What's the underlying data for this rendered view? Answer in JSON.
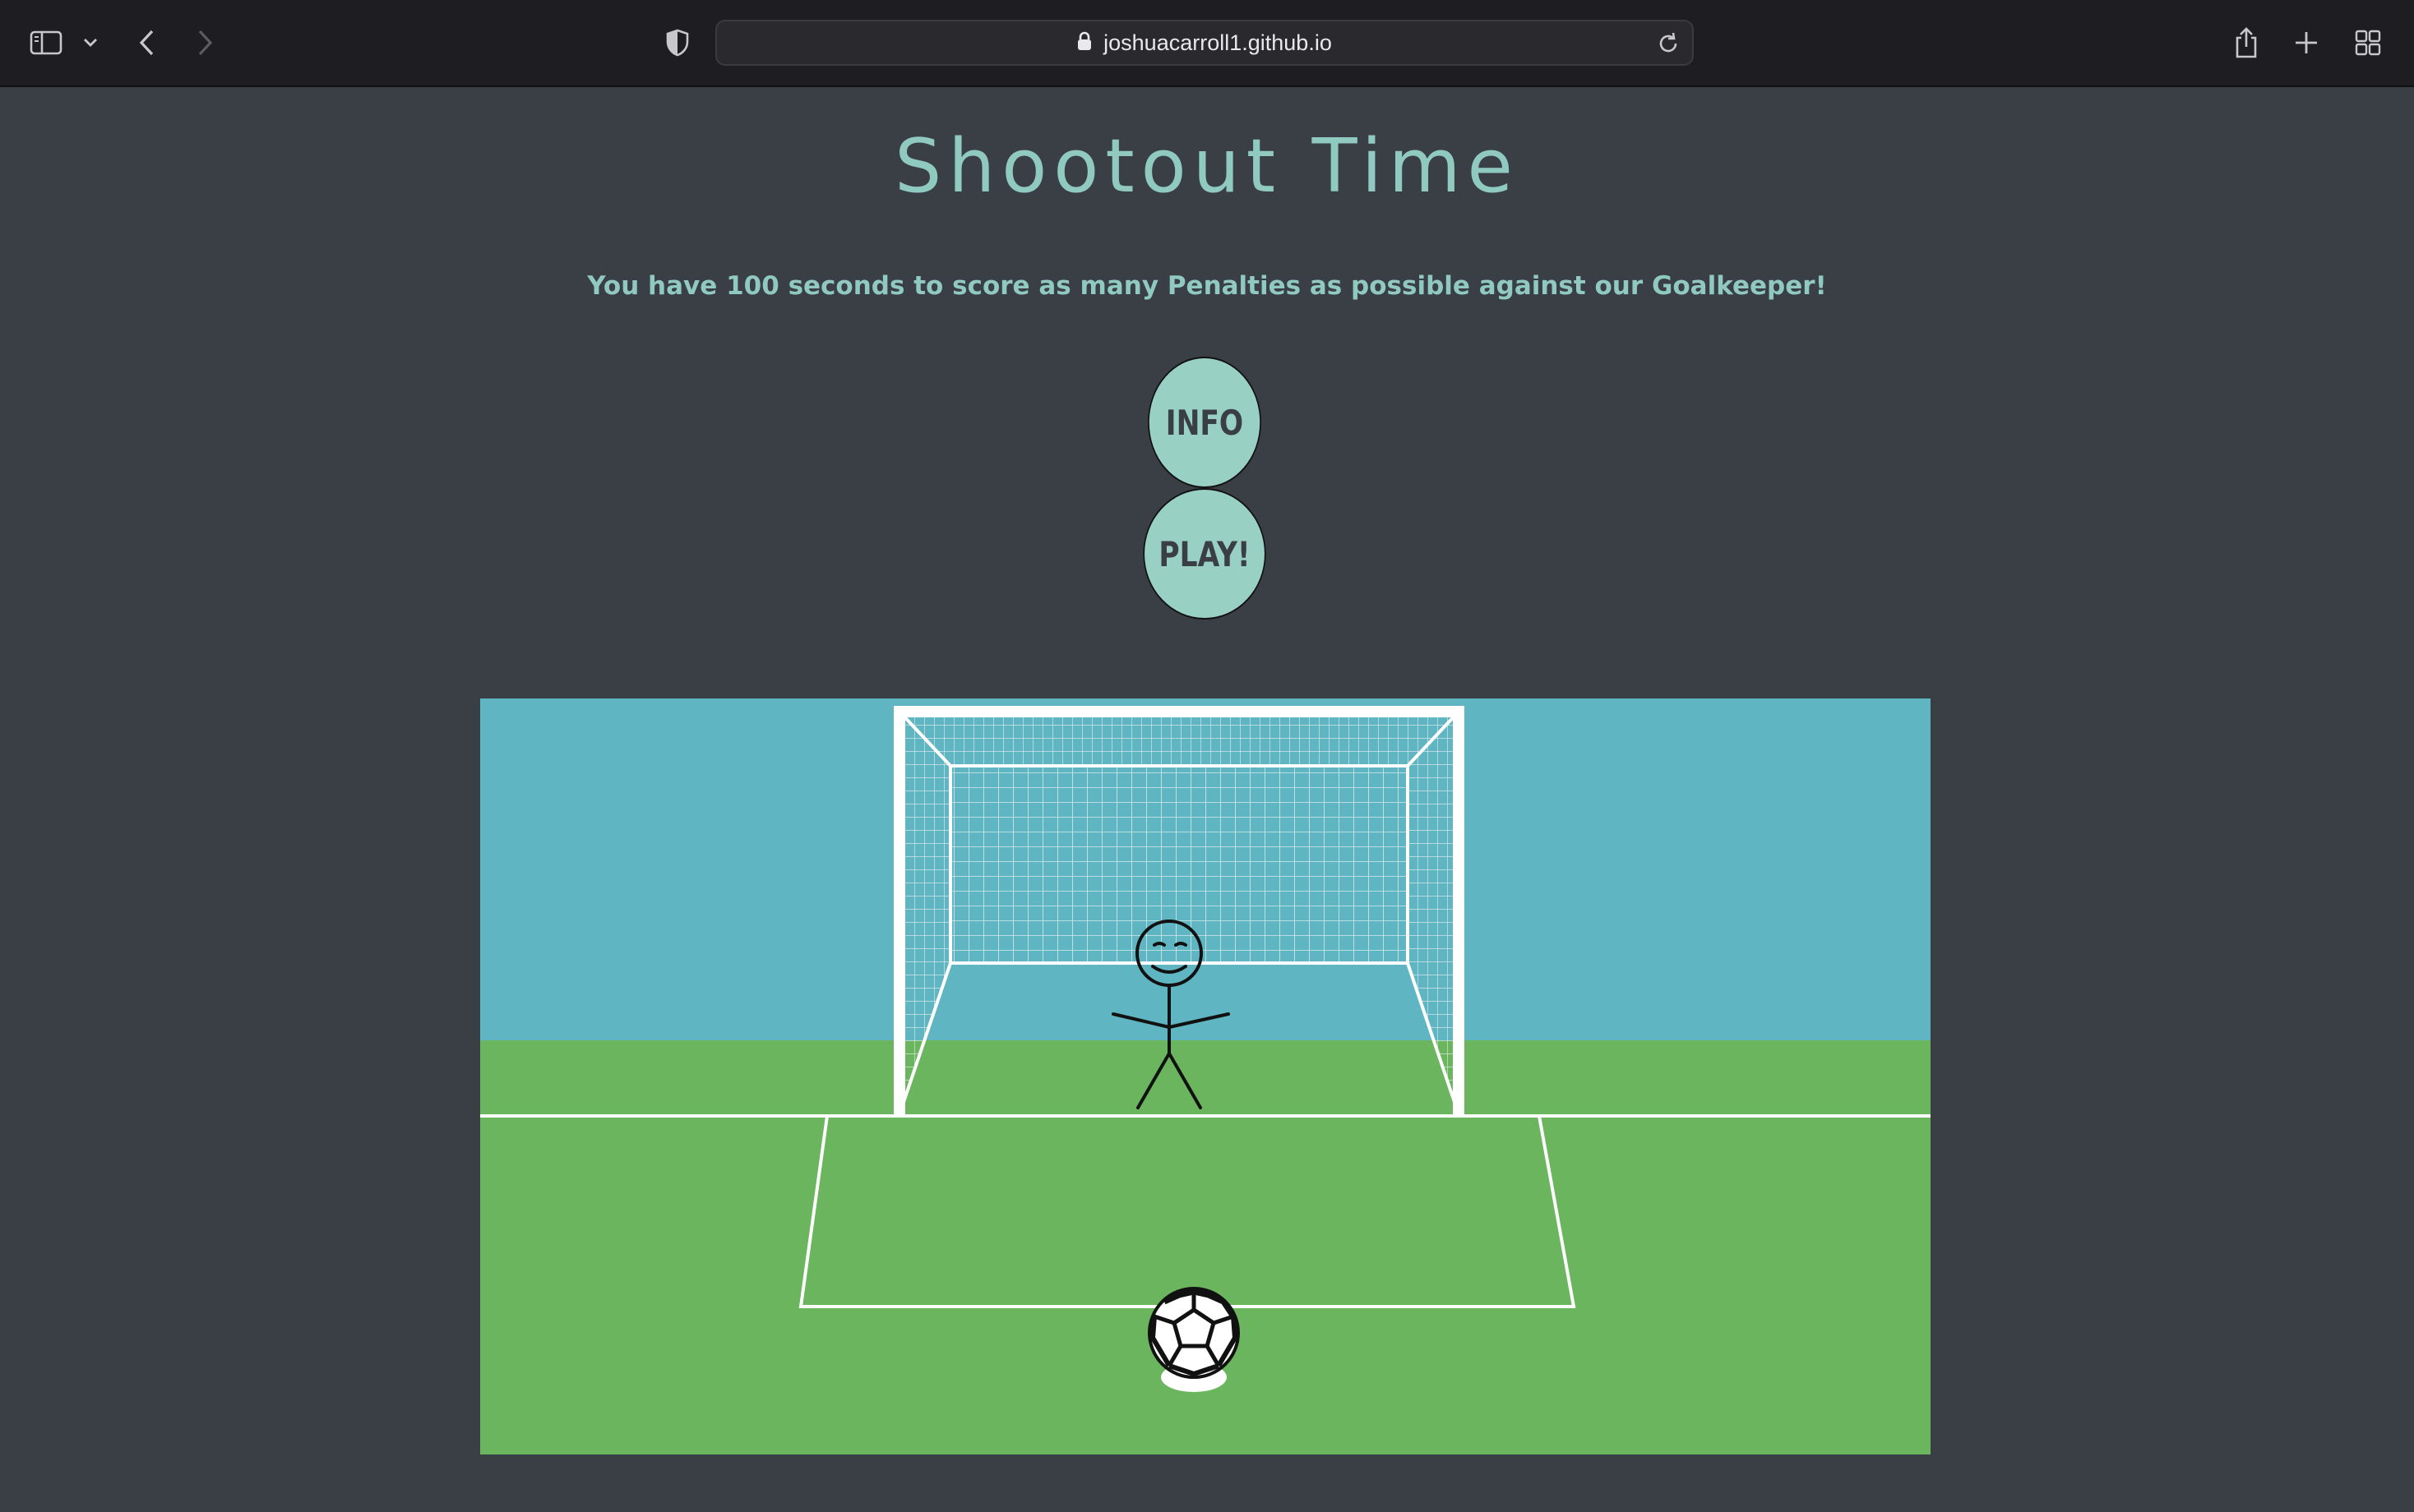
{
  "browser": {
    "url": "joshuacarroll1.github.io"
  },
  "page": {
    "title": "Shootout Time",
    "subtitle": "You have 100 seconds to score as many Penalties as possible against our Goalkeeper!",
    "buttons": {
      "info": "INFO",
      "play": "PLAY!"
    }
  },
  "colors": {
    "background": "#3a3e45",
    "accent": "#8fc9c0",
    "button": "#98d1c4",
    "sky": "#5fb5c2",
    "grass": "#6ab55d"
  },
  "icons": [
    "sidebar-icon",
    "chevron-down-icon",
    "back-arrow-icon",
    "forward-arrow-icon",
    "shield-icon",
    "lock-icon",
    "reload-icon",
    "share-icon",
    "new-tab-icon",
    "tab-overview-icon"
  ]
}
